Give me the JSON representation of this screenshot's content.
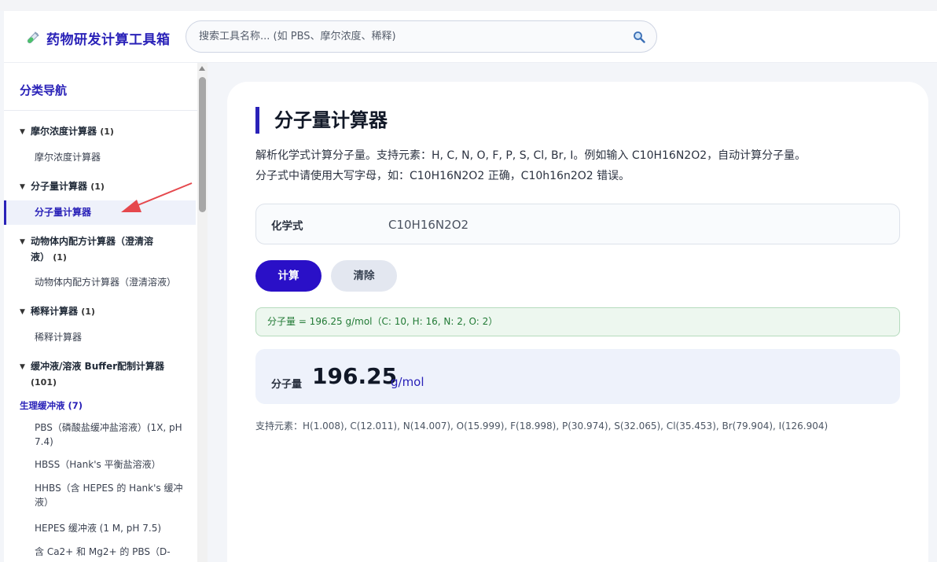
{
  "header": {
    "app_title": "药物研发计算工具箱",
    "search_placeholder": "搜索工具名称... (如 PBS、摩尔浓度、稀释)"
  },
  "sidebar": {
    "title": "分类导航",
    "categories": [
      {
        "arrow": "▼",
        "name": "摩尔浓度计算器",
        "count": "(1)",
        "items": [
          "摩尔浓度计算器"
        ]
      },
      {
        "arrow": "▼",
        "name": "分子量计算器",
        "count": "(1)",
        "items": [
          "分子量计算器"
        ]
      },
      {
        "arrow": "▼",
        "name_line1": "动物体内配方计算器（澄清溶",
        "name_line2": "液）",
        "count": "(1)",
        "items": [
          "动物体内配方计算器（澄清溶液）"
        ]
      },
      {
        "arrow": "▼",
        "name": "稀释计算器",
        "count": "(1)",
        "items": [
          "稀释计算器"
        ]
      },
      {
        "arrow": "▼",
        "name_line1": "缓冲液/溶液 Buffer配制计算器",
        "count": "(101)"
      }
    ],
    "group_label": "生理缓冲液 (7)",
    "buffer_items": [
      "PBS（磷酸盐缓冲盐溶液）(1X, pH 7.4)",
      "HBSS（Hank's 平衡盐溶液）",
      "HHBS（含 HEPES 的 Hank's 缓冲液）",
      "HEPES 缓冲液 (1 M, pH 7.5)",
      "含 Ca2+ 和 Mg2+ 的 PBS（D-"
    ]
  },
  "main": {
    "title": "分子量计算器",
    "desc_line1": "解析化学式计算分子量。支持元素：H, C, N, O, F, P, S, Cl, Br, I。例如输入 C10H16N2O2，自动计算分子量。",
    "desc_line2": "分子式中请使用大写字母，如：C10H16N2O2 正确，C10h16n2O2 错误。",
    "field_label": "化学式",
    "field_value": "C10H16N2O2",
    "calc_label": "计算",
    "clear_label": "清除",
    "message": "分子量 = 196.25 g/mol（C: 10, H: 16, N: 2, O: 2）",
    "result_label": "分子量",
    "result_value": "196.25",
    "result_unit": "g/mol",
    "note": "支持元素：H(1.008), C(12.011), N(14.007), O(15.999), F(18.998), P(30.974), S(32.065), Cl(35.453), Br(79.904), I(126.904)"
  },
  "colors": {
    "accent": "#2a22b8",
    "button_primary": "#2a10c7",
    "success_bg": "#edf7ef",
    "annotation_arrow": "#e5484d"
  }
}
